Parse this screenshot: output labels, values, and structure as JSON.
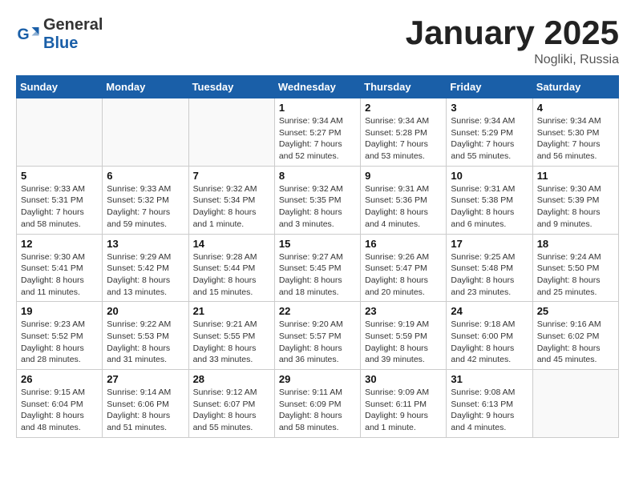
{
  "logo": {
    "line1": "General",
    "line2": "Blue"
  },
  "header": {
    "month_year": "January 2025",
    "location": "Nogliki, Russia"
  },
  "weekdays": [
    "Sunday",
    "Monday",
    "Tuesday",
    "Wednesday",
    "Thursday",
    "Friday",
    "Saturday"
  ],
  "weeks": [
    [
      {
        "day": "",
        "info": ""
      },
      {
        "day": "",
        "info": ""
      },
      {
        "day": "",
        "info": ""
      },
      {
        "day": "1",
        "info": "Sunrise: 9:34 AM\nSunset: 5:27 PM\nDaylight: 7 hours and 52 minutes."
      },
      {
        "day": "2",
        "info": "Sunrise: 9:34 AM\nSunset: 5:28 PM\nDaylight: 7 hours and 53 minutes."
      },
      {
        "day": "3",
        "info": "Sunrise: 9:34 AM\nSunset: 5:29 PM\nDaylight: 7 hours and 55 minutes."
      },
      {
        "day": "4",
        "info": "Sunrise: 9:34 AM\nSunset: 5:30 PM\nDaylight: 7 hours and 56 minutes."
      }
    ],
    [
      {
        "day": "5",
        "info": "Sunrise: 9:33 AM\nSunset: 5:31 PM\nDaylight: 7 hours and 58 minutes."
      },
      {
        "day": "6",
        "info": "Sunrise: 9:33 AM\nSunset: 5:32 PM\nDaylight: 7 hours and 59 minutes."
      },
      {
        "day": "7",
        "info": "Sunrise: 9:32 AM\nSunset: 5:34 PM\nDaylight: 8 hours and 1 minute."
      },
      {
        "day": "8",
        "info": "Sunrise: 9:32 AM\nSunset: 5:35 PM\nDaylight: 8 hours and 3 minutes."
      },
      {
        "day": "9",
        "info": "Sunrise: 9:31 AM\nSunset: 5:36 PM\nDaylight: 8 hours and 4 minutes."
      },
      {
        "day": "10",
        "info": "Sunrise: 9:31 AM\nSunset: 5:38 PM\nDaylight: 8 hours and 6 minutes."
      },
      {
        "day": "11",
        "info": "Sunrise: 9:30 AM\nSunset: 5:39 PM\nDaylight: 8 hours and 9 minutes."
      }
    ],
    [
      {
        "day": "12",
        "info": "Sunrise: 9:30 AM\nSunset: 5:41 PM\nDaylight: 8 hours and 11 minutes."
      },
      {
        "day": "13",
        "info": "Sunrise: 9:29 AM\nSunset: 5:42 PM\nDaylight: 8 hours and 13 minutes."
      },
      {
        "day": "14",
        "info": "Sunrise: 9:28 AM\nSunset: 5:44 PM\nDaylight: 8 hours and 15 minutes."
      },
      {
        "day": "15",
        "info": "Sunrise: 9:27 AM\nSunset: 5:45 PM\nDaylight: 8 hours and 18 minutes."
      },
      {
        "day": "16",
        "info": "Sunrise: 9:26 AM\nSunset: 5:47 PM\nDaylight: 8 hours and 20 minutes."
      },
      {
        "day": "17",
        "info": "Sunrise: 9:25 AM\nSunset: 5:48 PM\nDaylight: 8 hours and 23 minutes."
      },
      {
        "day": "18",
        "info": "Sunrise: 9:24 AM\nSunset: 5:50 PM\nDaylight: 8 hours and 25 minutes."
      }
    ],
    [
      {
        "day": "19",
        "info": "Sunrise: 9:23 AM\nSunset: 5:52 PM\nDaylight: 8 hours and 28 minutes."
      },
      {
        "day": "20",
        "info": "Sunrise: 9:22 AM\nSunset: 5:53 PM\nDaylight: 8 hours and 31 minutes."
      },
      {
        "day": "21",
        "info": "Sunrise: 9:21 AM\nSunset: 5:55 PM\nDaylight: 8 hours and 33 minutes."
      },
      {
        "day": "22",
        "info": "Sunrise: 9:20 AM\nSunset: 5:57 PM\nDaylight: 8 hours and 36 minutes."
      },
      {
        "day": "23",
        "info": "Sunrise: 9:19 AM\nSunset: 5:59 PM\nDaylight: 8 hours and 39 minutes."
      },
      {
        "day": "24",
        "info": "Sunrise: 9:18 AM\nSunset: 6:00 PM\nDaylight: 8 hours and 42 minutes."
      },
      {
        "day": "25",
        "info": "Sunrise: 9:16 AM\nSunset: 6:02 PM\nDaylight: 8 hours and 45 minutes."
      }
    ],
    [
      {
        "day": "26",
        "info": "Sunrise: 9:15 AM\nSunset: 6:04 PM\nDaylight: 8 hours and 48 minutes."
      },
      {
        "day": "27",
        "info": "Sunrise: 9:14 AM\nSunset: 6:06 PM\nDaylight: 8 hours and 51 minutes."
      },
      {
        "day": "28",
        "info": "Sunrise: 9:12 AM\nSunset: 6:07 PM\nDaylight: 8 hours and 55 minutes."
      },
      {
        "day": "29",
        "info": "Sunrise: 9:11 AM\nSunset: 6:09 PM\nDaylight: 8 hours and 58 minutes."
      },
      {
        "day": "30",
        "info": "Sunrise: 9:09 AM\nSunset: 6:11 PM\nDaylight: 9 hours and 1 minute."
      },
      {
        "day": "31",
        "info": "Sunrise: 9:08 AM\nSunset: 6:13 PM\nDaylight: 9 hours and 4 minutes."
      },
      {
        "day": "",
        "info": ""
      }
    ]
  ]
}
